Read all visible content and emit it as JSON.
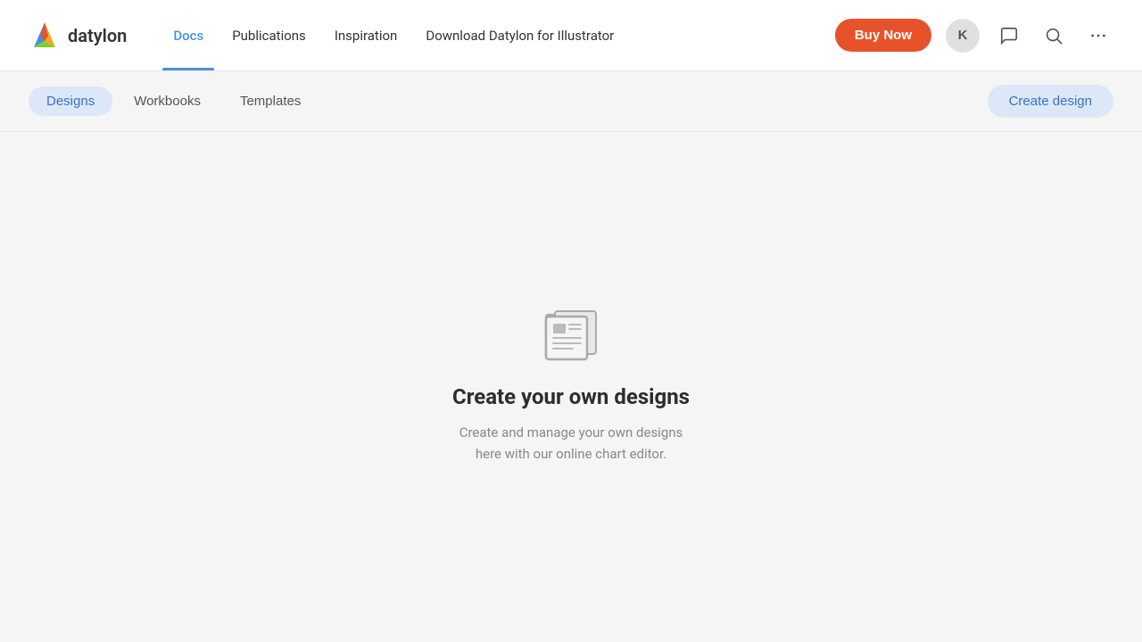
{
  "brand": {
    "name": "datylon",
    "logo_alt": "Datylon logo"
  },
  "navbar": {
    "links": [
      {
        "label": "Docs",
        "active": true
      },
      {
        "label": "Publications",
        "active": false
      },
      {
        "label": "Inspiration",
        "active": false
      },
      {
        "label": "Download Datylon for Illustrator",
        "active": false
      }
    ],
    "buy_now_label": "Buy Now",
    "avatar_letter": "K"
  },
  "tabs": {
    "items": [
      {
        "label": "Designs",
        "active": true
      },
      {
        "label": "Workbooks",
        "active": false
      },
      {
        "label": "Templates",
        "active": false
      }
    ],
    "create_design_label": "Create design"
  },
  "empty_state": {
    "title": "Create your own designs",
    "description": "Create and manage your own designs here with our online chart editor."
  }
}
